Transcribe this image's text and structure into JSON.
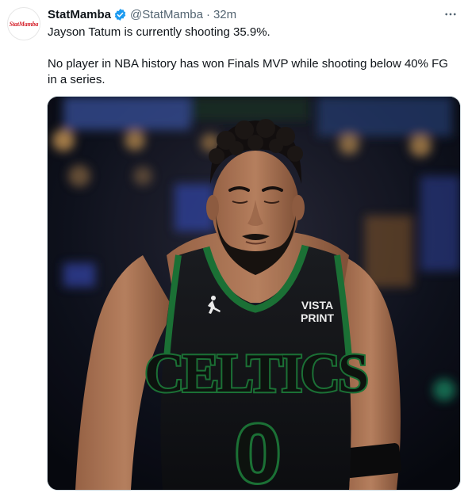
{
  "tweet": {
    "author": {
      "display_name": "StatMamba",
      "handle": "@StatMamba",
      "avatar_text": "StatMamba",
      "verified_icon": "verified-badge-icon"
    },
    "separator": "·",
    "timestamp": "32m",
    "more_icon": "more-horizontal-icon",
    "paragraphs": [
      "Jayson Tatum is currently shooting 35.9%.",
      "No player in NBA history has won Finals MVP while shooting below 40% FG in a series."
    ],
    "media": {
      "jersey_wordmark": "CELTICS",
      "jersey_number": "0",
      "sponsor_line1": "VISTA",
      "sponsor_line2": "PRINT",
      "jersey_logo_icon": "jumpman-logo-icon"
    }
  },
  "colors": {
    "verified_blue": "#1d9bf0",
    "secondary_text": "#536471",
    "jersey_green": "#1e7a3a",
    "jersey_black": "#15171a"
  }
}
